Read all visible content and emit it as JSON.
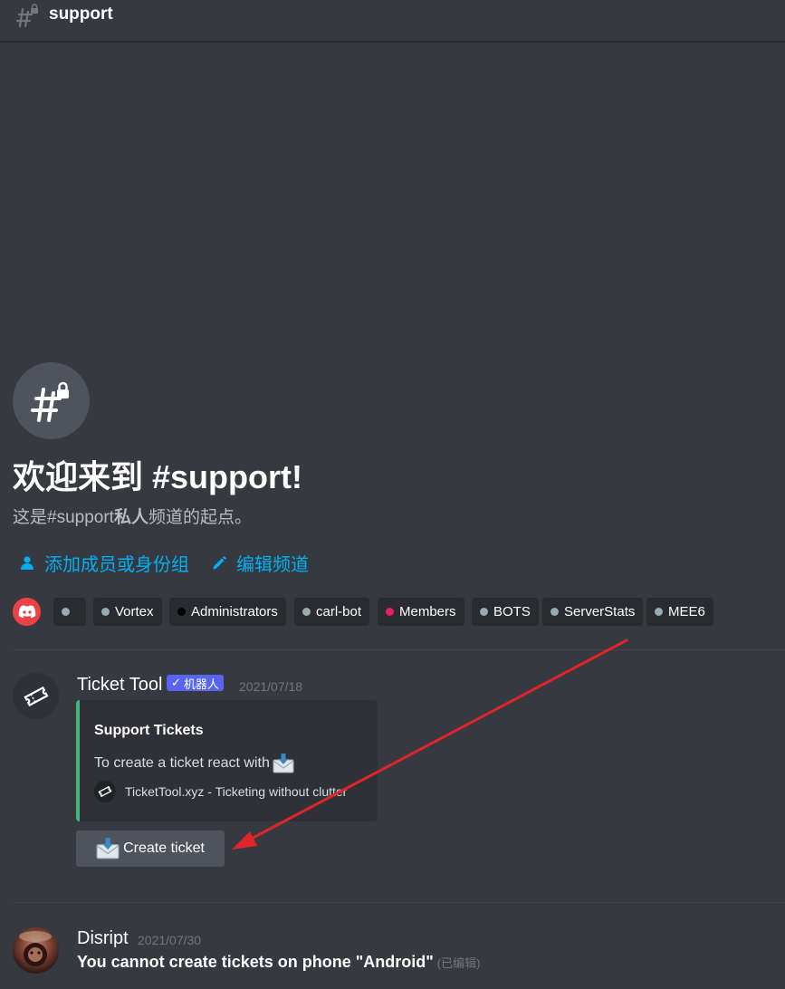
{
  "header": {
    "channel_name": "support",
    "channel_icon": "locked-hash-icon"
  },
  "welcome": {
    "title": "欢迎来到 #support!",
    "subtitle_prefix": "这是#support",
    "subtitle_bold": "私人",
    "subtitle_suffix": "频道的起点。",
    "add_members_label": "添加成员或身份组",
    "edit_channel_label": "编辑频道"
  },
  "roles": [
    {
      "label": "",
      "color": "#99aab5"
    },
    {
      "label": "Vortex",
      "color": "#99aab5"
    },
    {
      "label": "Administrators",
      "color": "#000000"
    },
    {
      "label": "carl-bot",
      "color": "#99aab5"
    },
    {
      "label": "Members",
      "color": "#e91e63"
    },
    {
      "label": "BOTS",
      "color": "#99aab5"
    },
    {
      "label": "ServerStats",
      "color": "#99aab5"
    },
    {
      "label": "MEE6",
      "color": "#99aab5"
    }
  ],
  "messages": [
    {
      "author": "Ticket Tool",
      "bot_tag": "机器人",
      "timestamp": "2021/07/18",
      "embed": {
        "title": "Support Tickets",
        "description": "To create a ticket react with",
        "footer": "TicketTool.xyz - Ticketing without clutter",
        "accent_color": "#43b581"
      },
      "button_label": "Create ticket"
    },
    {
      "author": "Disript",
      "timestamp": "2021/07/30",
      "text": "You cannot create tickets on phone \"Android\"",
      "edited_label": "(已编辑)"
    }
  ],
  "colors": {
    "background": "#36393f",
    "link": "#00aff4",
    "annotation_arrow": "#e0242a"
  }
}
